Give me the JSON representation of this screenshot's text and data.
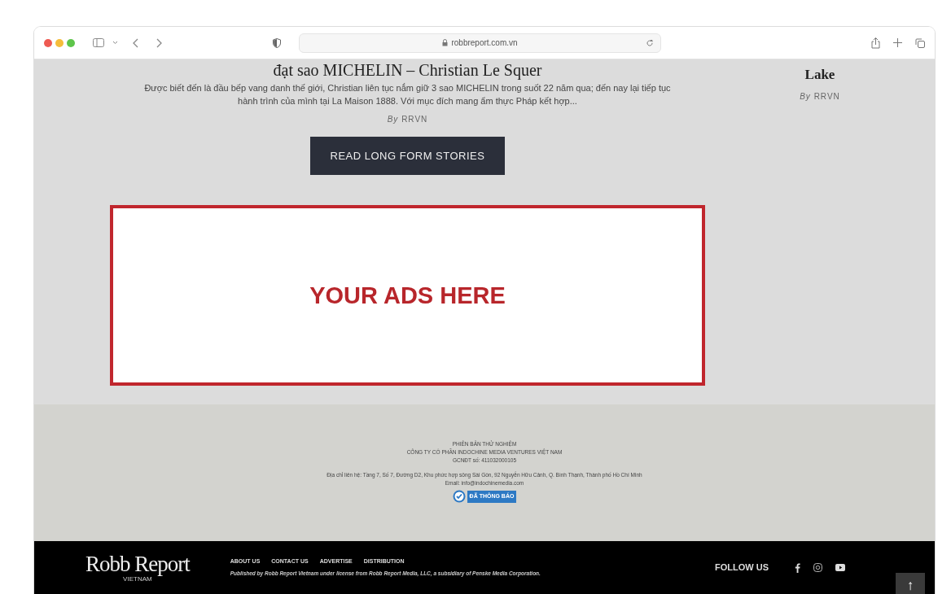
{
  "browser": {
    "url": "robbreport.com.vn"
  },
  "stories": [
    {
      "title": "đạt sao MICHELIN – Christian Le Squer",
      "excerpt": "Được biết đến là đầu bếp vang danh thế giới, Christian liên tục nắm giữ 3 sao MICHELIN trong suốt 22 năm qua; đến nay lại tiếp tục hành trình của mình tại La Maison 1888. Với mục đích mang ẩm thực Pháp kết hợp...",
      "byline": "*By* RRVN"
    },
    {
      "title": "Lake",
      "byline": "*By* RRVN"
    }
  ],
  "read_more_button": "READ LONG FORM STORIES",
  "ad": {
    "text": "YOUR ADS HERE"
  },
  "company_info": {
    "lines": [
      "PHIÊN BẢN THỬ NGHIỆM",
      "CÔNG TY CỔ PHẦN INDOCHINE MEDIA VENTURES VIỆT NAM",
      "GCNĐT số: 411032000105"
    ],
    "address": "Địa chỉ liên hệ: Tầng 7, Số 7, Đường D2, Khu phức hợp sông Sài Gòn, 92 Nguyễn Hữu Cảnh, Q. Bình Thạnh, Thành phố Hồ Chí Minh",
    "email": "Email: info@indochinemedia.com",
    "badge": "ĐÃ THÔNG BÁO"
  },
  "footer": {
    "logo": "Robb Report",
    "logo_sub": "VIETNAM",
    "links": [
      "ABOUT US",
      "CONTACT US",
      "ADVERTISE",
      "DISTRIBUTION"
    ],
    "published": "Published by Robb Report Vietnam under license from Robb Report Media, LLC, a subsidiary of Penske Media Corporation.",
    "follow": "FOLLOW US",
    "scroll_top": "↑"
  }
}
